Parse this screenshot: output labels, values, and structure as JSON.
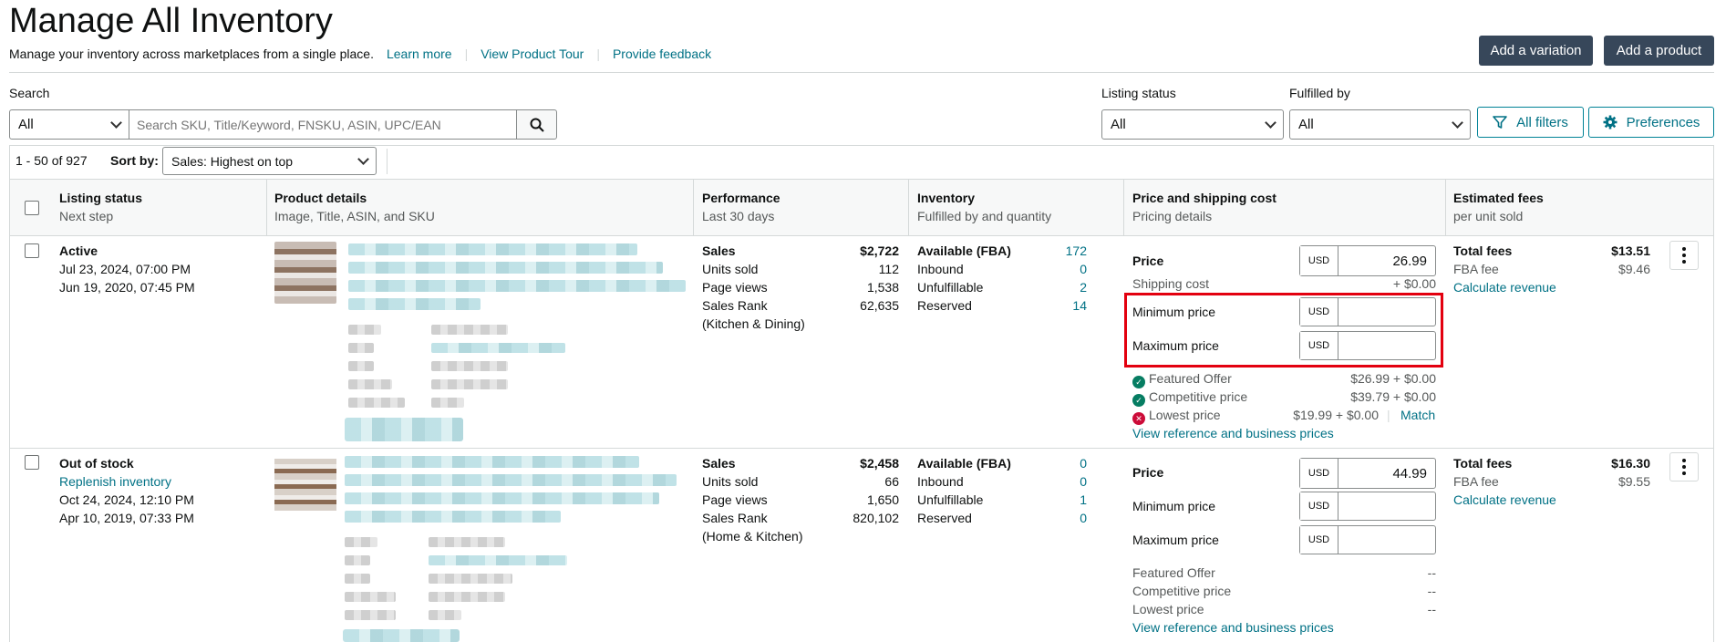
{
  "header": {
    "title": "Manage All Inventory",
    "subtitle": "Manage your inventory across marketplaces from a single place.",
    "links": [
      "Learn more",
      "View Product Tour",
      "Provide feedback"
    ],
    "add_variation": "Add a variation",
    "add_product": "Add a product"
  },
  "search": {
    "label": "Search",
    "scope": "All",
    "placeholder": "Search SKU, Title/Keyword, FNSKU, ASIN, UPC/EAN"
  },
  "filters": {
    "listing_status_label": "Listing status",
    "listing_status_value": "All",
    "fulfilled_by_label": "Fulfilled by",
    "fulfilled_by_value": "All",
    "all_filters": "All filters",
    "preferences": "Preferences"
  },
  "pagination": {
    "range": "1 - 50 of 927",
    "sort_label": "Sort by:",
    "sort_value": "Sales: Highest on top"
  },
  "columns": [
    {
      "title": "Listing status",
      "sub": "Next step"
    },
    {
      "title": "Product details",
      "sub": "Image, Title, ASIN, and SKU"
    },
    {
      "title": "Performance",
      "sub": "Last 30 days"
    },
    {
      "title": "Inventory",
      "sub": "Fulfilled by and quantity"
    },
    {
      "title": "Price and shipping cost",
      "sub": "Pricing details"
    },
    {
      "title": "Estimated fees",
      "sub": "per unit sold"
    }
  ],
  "rows": [
    {
      "status": "Active",
      "next_step": "",
      "date1": "Jul 23, 2024, 07:00 PM",
      "date2": "Jun 19, 2020, 07:45 PM",
      "perf": {
        "sales_label": "Sales",
        "sales": "$2,722",
        "units_label": "Units sold",
        "units": "112",
        "views_label": "Page views",
        "views": "1,538",
        "rank_label": "Sales Rank",
        "rank": "62,635",
        "category": "(Kitchen & Dining)"
      },
      "inv": {
        "available_label": "Available (FBA)",
        "available": "172",
        "inbound_label": "Inbound",
        "inbound": "0",
        "unfulfillable_label": "Unfulfillable",
        "unfulfillable": "2",
        "reserved_label": "Reserved",
        "reserved": "14"
      },
      "price": {
        "price_label": "Price",
        "currency": "USD",
        "price": "26.99",
        "shipping_label": "Shipping cost",
        "shipping": "+ $0.00",
        "min_label": "Minimum price",
        "max_label": "Maximum price",
        "featured_label": "Featured Offer",
        "featured": "$26.99 + $0.00",
        "competitive_label": "Competitive price",
        "competitive": "$39.79 + $0.00",
        "lowest_label": "Lowest price",
        "lowest": "$19.99 + $0.00",
        "match": "Match",
        "reference": "View reference and business prices"
      },
      "fees": {
        "total_label": "Total fees",
        "total": "$13.51",
        "fba_label": "FBA fee",
        "fba": "$9.46",
        "calc": "Calculate revenue"
      }
    },
    {
      "status": "Out of stock",
      "next_step": "Replenish inventory",
      "date1": "Oct 24, 2024, 12:10 PM",
      "date2": "Apr 10, 2019, 07:33 PM",
      "perf": {
        "sales_label": "Sales",
        "sales": "$2,458",
        "units_label": "Units sold",
        "units": "66",
        "views_label": "Page views",
        "views": "1,650",
        "rank_label": "Sales Rank",
        "rank": "820,102",
        "category": "(Home & Kitchen)"
      },
      "inv": {
        "available_label": "Available (FBA)",
        "available": "0",
        "inbound_label": "Inbound",
        "inbound": "0",
        "unfulfillable_label": "Unfulfillable",
        "unfulfillable": "1",
        "reserved_label": "Reserved",
        "reserved": "0"
      },
      "price": {
        "price_label": "Price",
        "currency": "USD",
        "price": "44.99",
        "min_label": "Minimum price",
        "max_label": "Maximum price",
        "featured_label": "Featured Offer",
        "featured": "--",
        "competitive_label": "Competitive price",
        "competitive": "--",
        "lowest_label": "Lowest price",
        "lowest": "--",
        "reference": "View reference and business prices"
      },
      "fees": {
        "total_label": "Total fees",
        "total": "$16.30",
        "fba_label": "FBA fee",
        "fba": "$9.55",
        "calc": "Calculate revenue"
      }
    }
  ],
  "colors": {
    "link": "#007185",
    "dark_button": "#37475a",
    "highlight": "#e3000f"
  }
}
